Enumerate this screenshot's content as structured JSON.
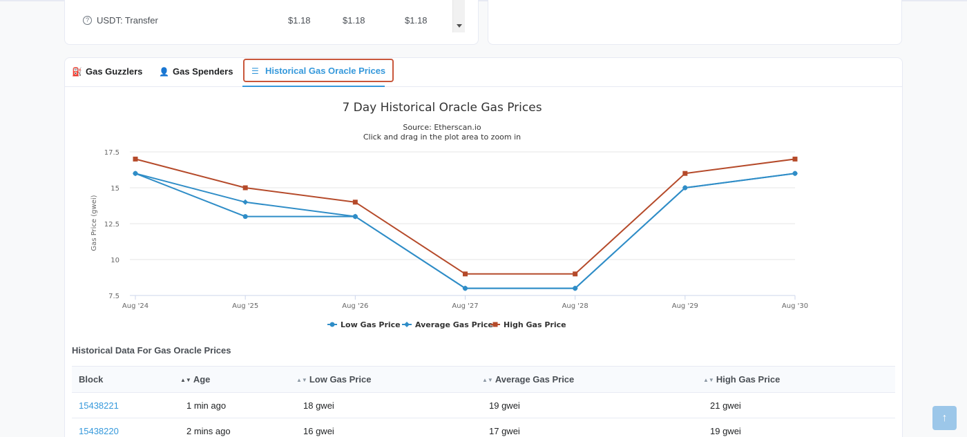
{
  "top_table": {
    "row": {
      "help_icon": "question-circle-icon",
      "name": "USDT: Transfer",
      "v1": "$1.18",
      "v2": "$1.18",
      "v3": "$1.18"
    }
  },
  "tabs": [
    {
      "label": "Gas Guzzlers",
      "icon": "gas-pump-icon"
    },
    {
      "label": "Gas Spenders",
      "icon": "person-icon"
    },
    {
      "label": "Historical Gas Oracle Prices",
      "icon": "list-icon"
    }
  ],
  "colors": {
    "accent": "#3498db",
    "low": "#2f8dc7",
    "average": "#2f8dc7",
    "high": "#b54a2a",
    "highlight_border": "#c8563a"
  },
  "chart_data": {
    "type": "line",
    "title": "7 Day Historical Oracle Gas Prices",
    "subtitle_lines": [
      "Source: Etherscan.io",
      "Click and drag in the plot area to zoom in"
    ],
    "ylabel": "Gas Price (gwei)",
    "xlabel": "",
    "categories": [
      "Aug '24",
      "Aug '25",
      "Aug '26",
      "Aug '27",
      "Aug '28",
      "Aug '29",
      "Aug '30"
    ],
    "yticks": [
      "7.5",
      "10",
      "12.5",
      "15",
      "17.5"
    ],
    "ylim": [
      7.5,
      17.5
    ],
    "grid": true,
    "legend": "bottom-center",
    "series": [
      {
        "name": "Low Gas Price",
        "marker": "circle",
        "color": "#2f8dc7",
        "values": [
          16,
          13,
          13,
          8,
          8,
          15,
          16
        ]
      },
      {
        "name": "Average Gas Price",
        "marker": "diamond",
        "color": "#2f8dc7",
        "values": [
          16,
          14,
          13,
          8,
          8,
          15,
          16
        ]
      },
      {
        "name": "High Gas Price",
        "marker": "square",
        "color": "#b54a2a",
        "values": [
          17,
          15,
          14,
          9,
          9,
          16,
          17
        ]
      }
    ]
  },
  "historical": {
    "title": "Historical Data For Gas Oracle Prices",
    "columns": [
      "Block",
      "Age",
      "Low Gas Price",
      "Average Gas Price",
      "High Gas Price"
    ],
    "rows": [
      {
        "block": "15438221",
        "age": "1 min ago",
        "low": "18 gwei",
        "avg": "19 gwei",
        "high": "21 gwei"
      },
      {
        "block": "15438220",
        "age": "2 mins ago",
        "low": "16 gwei",
        "avg": "17 gwei",
        "high": "19 gwei"
      }
    ]
  },
  "back_to_top": {
    "icon": "arrow-up-icon",
    "glyph": "↑"
  }
}
